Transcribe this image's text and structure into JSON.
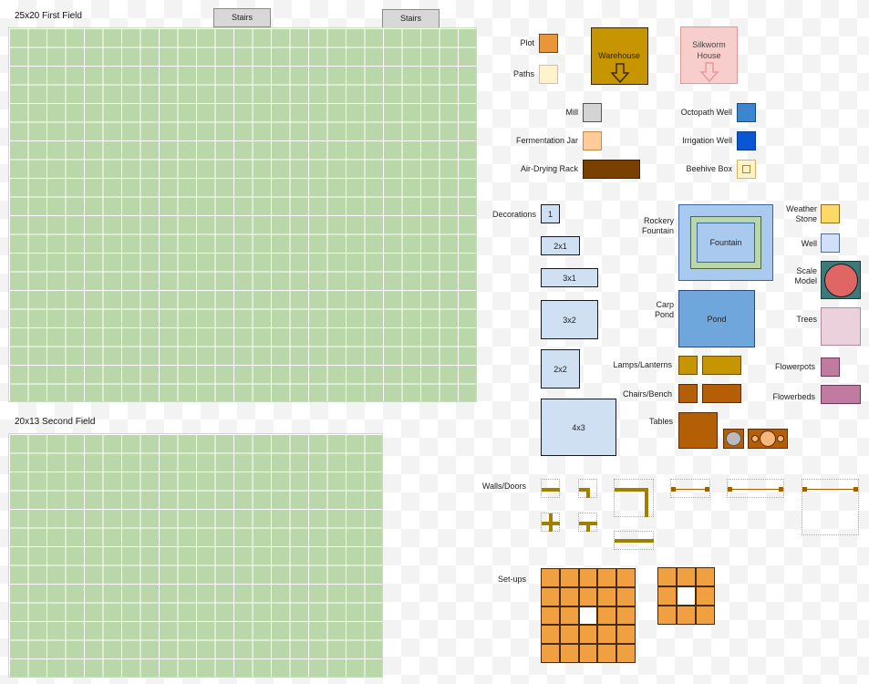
{
  "fields": {
    "first": {
      "title": "25x20 First Field"
    },
    "second": {
      "title": "20x13 Second Field"
    },
    "stairs": [
      "Stairs",
      "Stairs"
    ]
  },
  "legend": {
    "plot": "Plot",
    "paths": "Paths",
    "warehouse": "Warehouse",
    "silkworm": "Silkworm\nHouse",
    "mill": "Mill",
    "fermentation": "Fermentation Jar",
    "drying": "Air-Drying Rack",
    "octopath": "Octopath Well",
    "irrigation": "Irrigation Well",
    "beehive": "Beehive Box"
  },
  "decorations": {
    "label": "Decorations",
    "sizes": [
      "1",
      "2x1",
      "3x1",
      "3x2",
      "2x2",
      "4x3"
    ]
  },
  "features": {
    "rockery_label": "Rockery\nFountain",
    "fountain": "Fountain",
    "carp_label": "Carp\nPond",
    "pond": "Pond",
    "lamps": "Lamps/Lanterns",
    "chairs": "Chairs/Bench",
    "tables": "Tables",
    "weather": "Weather\nStone",
    "well": "Well",
    "scale": "Scale\nModel",
    "trees": "Trees",
    "flowerpots": "Flowerpots",
    "flowerbeds": "Flowerbeds",
    "walls": "Walls/Doors",
    "setups": "Set-ups"
  },
  "colors": {
    "field_green": "#b9d7a8",
    "plot": "#e9953a",
    "paths": "#fff2cc",
    "warehouse": "#c69500",
    "silkworm": "#f8cecc",
    "mill": "#d4d4d4",
    "fermentation": "#ffcc99",
    "drying": "#7a4000",
    "octopath": "#3c86d0",
    "irrigation": "#0a56d4",
    "beehive": "#fff2cc",
    "decoration": "#cfe0f2",
    "pond": "#6fa6dc",
    "lamp": "#c69500",
    "chair": "#b45f06",
    "weather": "#ffd966",
    "well": "#d0e0f8",
    "scale": "#e06666",
    "trees": "#ead1dc",
    "flower": "#c27ba0",
    "wall": "#a08000"
  }
}
